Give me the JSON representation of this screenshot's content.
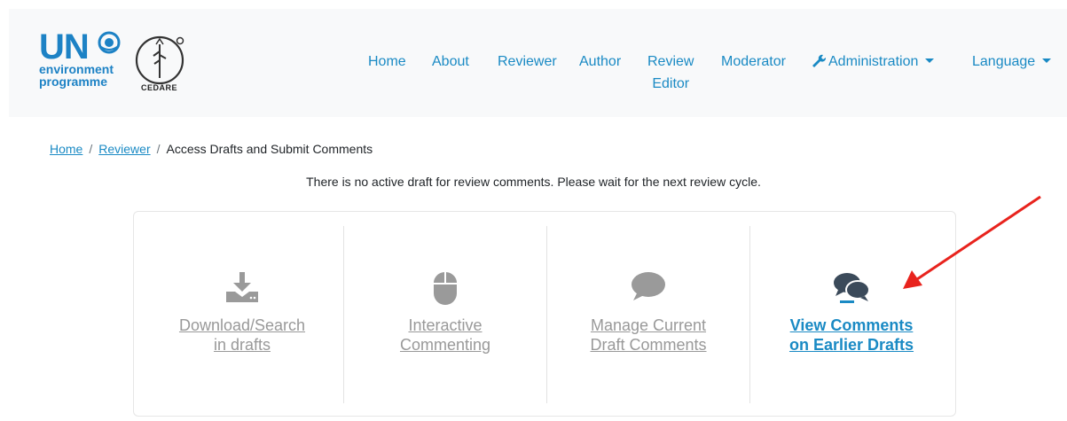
{
  "navbar": {
    "logo_un": {
      "big": "UN",
      "line1": "environment",
      "line2": "programme"
    },
    "logo_cedare": {
      "text": "CEDARE"
    },
    "items": [
      {
        "label": "Home"
      },
      {
        "label": "About"
      },
      {
        "label": "Reviewer"
      },
      {
        "label": "Author"
      },
      {
        "label_line1": "Review",
        "label_line2": "Editor"
      },
      {
        "label": "Moderator"
      },
      {
        "label": "Administration",
        "icon": "wrench-icon"
      },
      {
        "label": "Language"
      }
    ]
  },
  "breadcrumb": {
    "items": [
      "Home",
      "Reviewer"
    ],
    "current": "Access Drafts and Submit Comments",
    "separator": "/"
  },
  "notice": "There is no active draft for review comments. Please wait for the next review cycle.",
  "options": [
    {
      "line1": "Download/Search",
      "line2": "in drafts",
      "icon": "download-icon"
    },
    {
      "line1": "Interactive",
      "line2": "Commenting",
      "icon": "mouse-icon"
    },
    {
      "line1": "Manage Current",
      "line2": "Draft Comments",
      "icon": "comment-icon"
    },
    {
      "line1": "View Comments",
      "line2": "on Earlier Drafts",
      "icon": "comments-icon"
    }
  ],
  "colors": {
    "link": "#1a8ac4",
    "disabled": "#999999",
    "navbar_bg": "#f8f9fa",
    "annotation_arrow": "#e8231d"
  }
}
